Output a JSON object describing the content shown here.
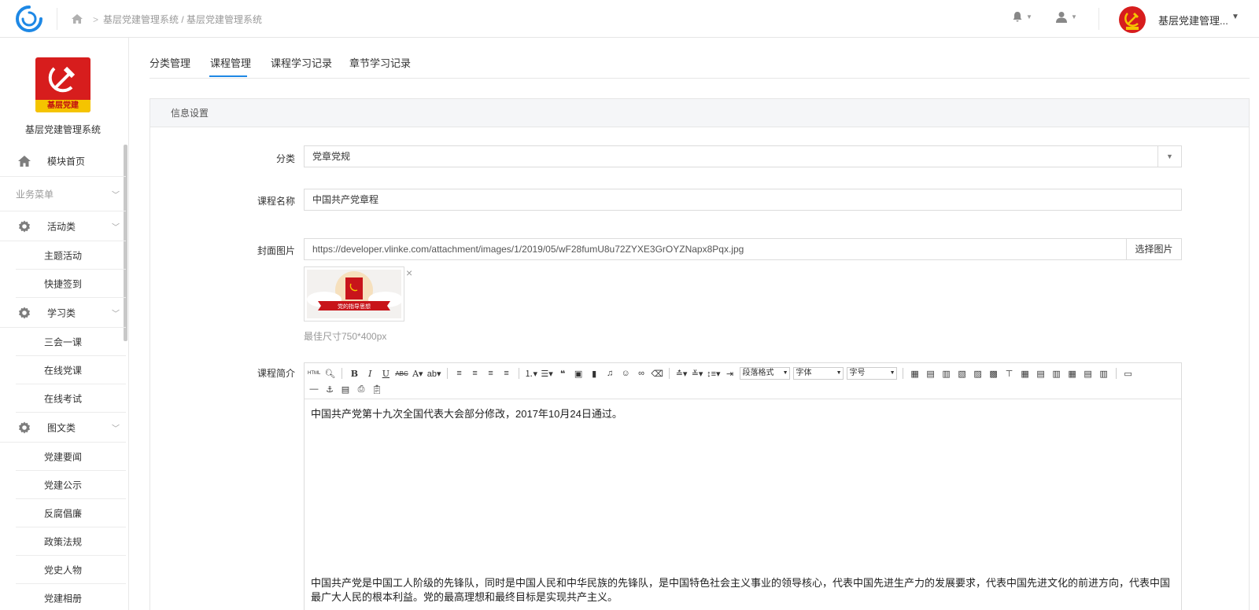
{
  "topbar": {
    "breadcrumb": [
      "基层党建管理系统",
      "基层党建管理系统"
    ],
    "user_name": "基层党建管理...",
    "icons": [
      "app-logo-icon",
      "home-icon",
      "bell-icon",
      "user-icon",
      "party-avatar"
    ]
  },
  "sidebar": {
    "brand_logo_text": "基层党建",
    "brand_name": "基层党建管理系统",
    "home_label": "模块首页",
    "section_label": "业务菜单",
    "groups": [
      {
        "label": "活动类",
        "items": [
          "主题活动",
          "快捷签到"
        ]
      },
      {
        "label": "学习类",
        "items": [
          "三会一课",
          "在线党课",
          "在线考试"
        ]
      },
      {
        "label": "图文类",
        "items": [
          "党建要闻",
          "党建公示",
          "反腐倡廉",
          "政策法规",
          "党史人物",
          "党建相册"
        ]
      }
    ]
  },
  "tabs": [
    "分类管理",
    "课程管理",
    "课程学习记录",
    "章节学习记录"
  ],
  "active_tab": "课程管理",
  "panel": {
    "title": "信息设置",
    "fields": {
      "category_label": "分类",
      "category_value": "党章党规",
      "course_name_label": "课程名称",
      "course_name_value": "中国共产党章程",
      "cover_label": "封面图片",
      "cover_url": "https://developer.vlinke.com/attachment/images/1/2019/05/wF28fumU8u72ZYXE3GrOYZNapx8Pqx.jpg",
      "choose_image_label": "选择图片",
      "thumb_banner_text": "党的指导思想",
      "size_hint": "最佳尺寸750*400px",
      "intro_label": "课程简介"
    },
    "editor": {
      "toolbar_selects": [
        "段落格式",
        "字体",
        "字号"
      ],
      "paragraph1": "中国共产党第十九次全国代表大会部分修改，2017年10月24日通过。",
      "paragraph2": "中国共产党是中国工人阶级的先锋队，同时是中国人民和中华民族的先锋队，是中国特色社会主义事业的领导核心，代表中国先进生产力的发展要求，代表中国先进文化的前进方向，代表中国最广大人民的根本利益。党的最高理想和最终目标是实现共产主义。"
    }
  },
  "colors": {
    "accent": "#1e88e5",
    "party_red": "#d71d1d",
    "party_yellow": "#f5c400"
  }
}
